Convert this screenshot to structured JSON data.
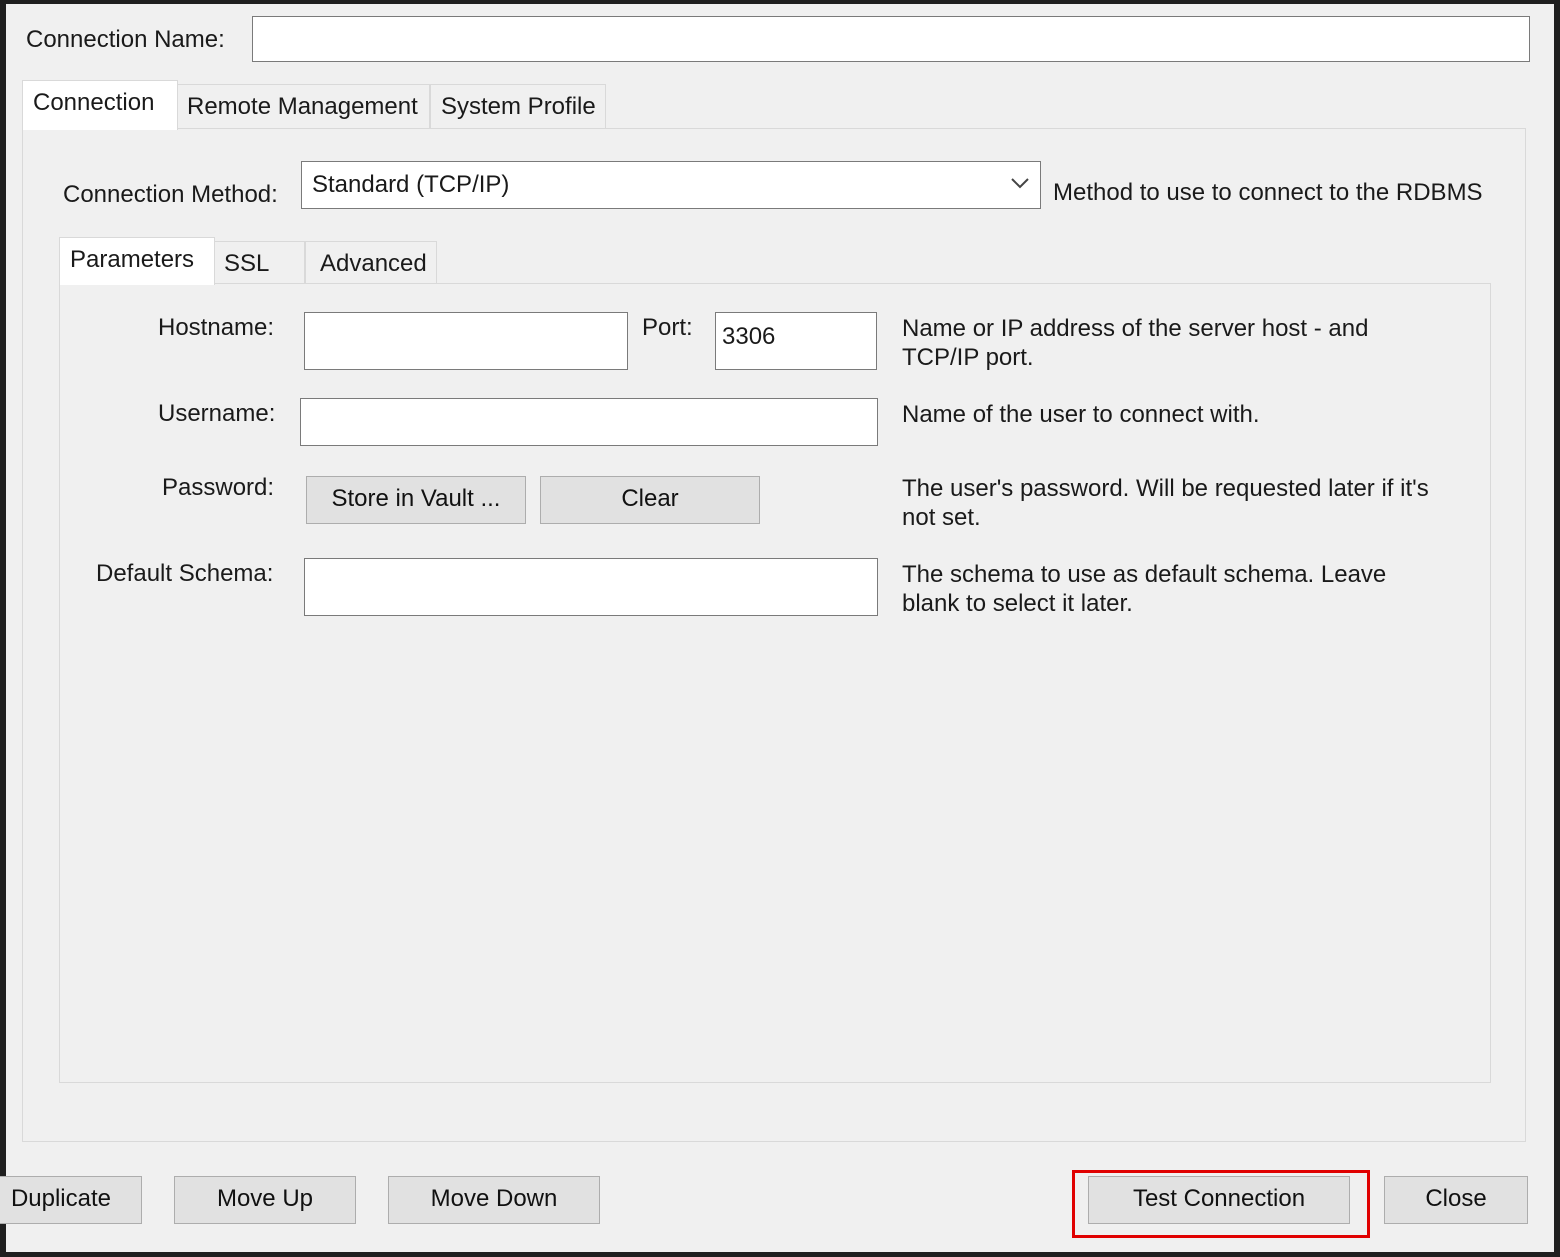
{
  "connection_name": {
    "label": "Connection Name:",
    "value": ""
  },
  "top_tabs": [
    {
      "label": "Connection",
      "active": true
    },
    {
      "label": "Remote Management",
      "active": false
    },
    {
      "label": "System Profile",
      "active": false
    }
  ],
  "connection_method": {
    "label": "Connection Method:",
    "selected": "Standard (TCP/IP)",
    "help": "Method to use to connect to the RDBMS"
  },
  "sub_tabs": [
    {
      "label": "Parameters",
      "active": true
    },
    {
      "label": "SSL",
      "active": false
    },
    {
      "label": "Advanced",
      "active": false
    }
  ],
  "params": {
    "hostname": {
      "label": "Hostname:",
      "value": ""
    },
    "port": {
      "label": "Port:",
      "value": "3306"
    },
    "host_help_1": "Name or IP address of the server host - and",
    "host_help_2": "TCP/IP port.",
    "username": {
      "label": "Username:",
      "value": "",
      "help": "Name of the user to connect with."
    },
    "password": {
      "label": "Password:",
      "store_button": "Store in Vault ...",
      "clear_button": "Clear",
      "help_1": "The user's password. Will be requested later if it's",
      "help_2": "not set."
    },
    "schema": {
      "label": "Default Schema:",
      "value": "",
      "help_1": "The schema to use as default schema. Leave",
      "help_2": "blank to select it later."
    }
  },
  "footer": {
    "duplicate": "Duplicate",
    "move_up": "Move Up",
    "move_down": "Move Down",
    "test_connection": "Test Connection",
    "close": "Close"
  },
  "colors": {
    "highlight": "#e00000",
    "window_bg": "#f0f0f0"
  }
}
